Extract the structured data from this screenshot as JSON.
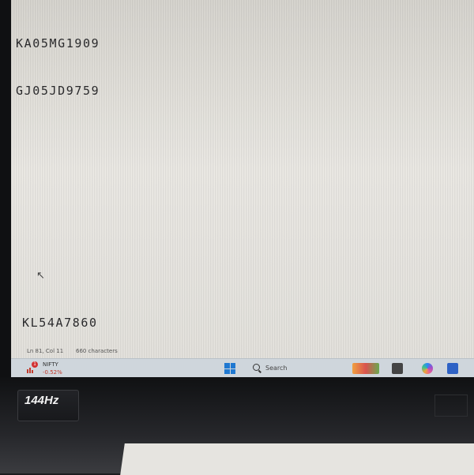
{
  "editor": {
    "lines": [
      "KA05MG1909",
      "GJ05JD9759",
      "KL54A7860"
    ]
  },
  "status": {
    "position": "Ln 81, Col 11",
    "chars": "660 characters"
  },
  "taskbar": {
    "widget": {
      "name": "NIFTY",
      "change": "-0.52%",
      "badge": "1",
      "change_color": "#c0392b"
    },
    "search_label": "Search",
    "accent_color": "#1f78d1",
    "apps": [
      "widgets-icon",
      "file-explorer-icon",
      "copilot-icon",
      "teams-icon"
    ]
  },
  "hardware": {
    "refresh_badge": "144Hz"
  }
}
